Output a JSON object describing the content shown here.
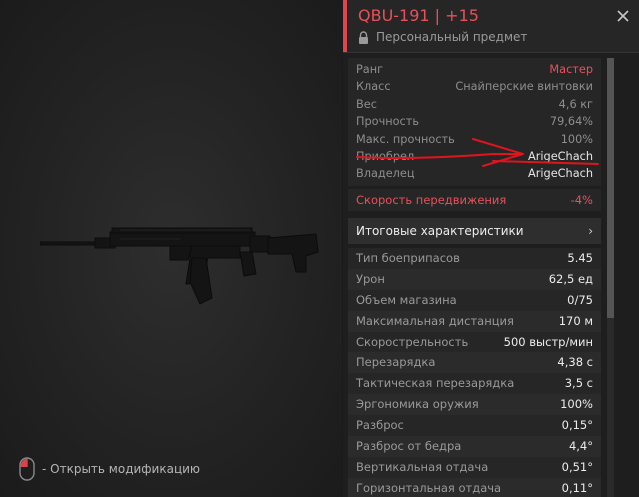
{
  "item": {
    "title": "QBU-191 | +15",
    "subtitle": "Персональный предмет"
  },
  "info_rows": [
    {
      "label": "Ранг",
      "value": "Мастер"
    },
    {
      "label": "Класс",
      "value": "Снайперские винтовки"
    },
    {
      "label": "Вес",
      "value": "4,6 кг"
    },
    {
      "label": "Прочность",
      "value": "79,64%"
    },
    {
      "label": "Макс. прочность",
      "value": "100%"
    },
    {
      "label": "Приобрел",
      "value": "ArigeChach"
    },
    {
      "label": "Владелец",
      "value": "ArigeChach"
    }
  ],
  "movement": {
    "label": "Скорость передвижения",
    "value": "-4%"
  },
  "summary": {
    "label": "Итоговые характеристики",
    "arrow": "›"
  },
  "stats": [
    {
      "label": "Тип боеприпасов",
      "value": "5.45"
    },
    {
      "label": "Урон",
      "value": "62,5 ед"
    },
    {
      "label": "Объем магазина",
      "value": "0/75"
    },
    {
      "label": "Максимальная дистанция",
      "value": "170 м"
    },
    {
      "label": "Скорострельность",
      "value": "500 выстр/мин"
    },
    {
      "label": "Перезарядка",
      "value": "4,38 с"
    },
    {
      "label": "Тактическая перезарядка",
      "value": "3,5 с"
    },
    {
      "label": "Эргономика оружия",
      "value": "100%"
    },
    {
      "label": "Разброс",
      "value": "0,15°"
    },
    {
      "label": "Разброс от бедра",
      "value": "4,4°"
    },
    {
      "label": "Вертикальная отдача",
      "value": "0,51°"
    },
    {
      "label": "Горизонтальная отдача",
      "value": "0,11°"
    }
  ],
  "hint": {
    "text": "- Открыть модификацию",
    "icon": "mouse-icon"
  },
  "colors": {
    "accent": "#e8505a",
    "background": "#1a1a1a",
    "annotation": "#e0141e"
  }
}
